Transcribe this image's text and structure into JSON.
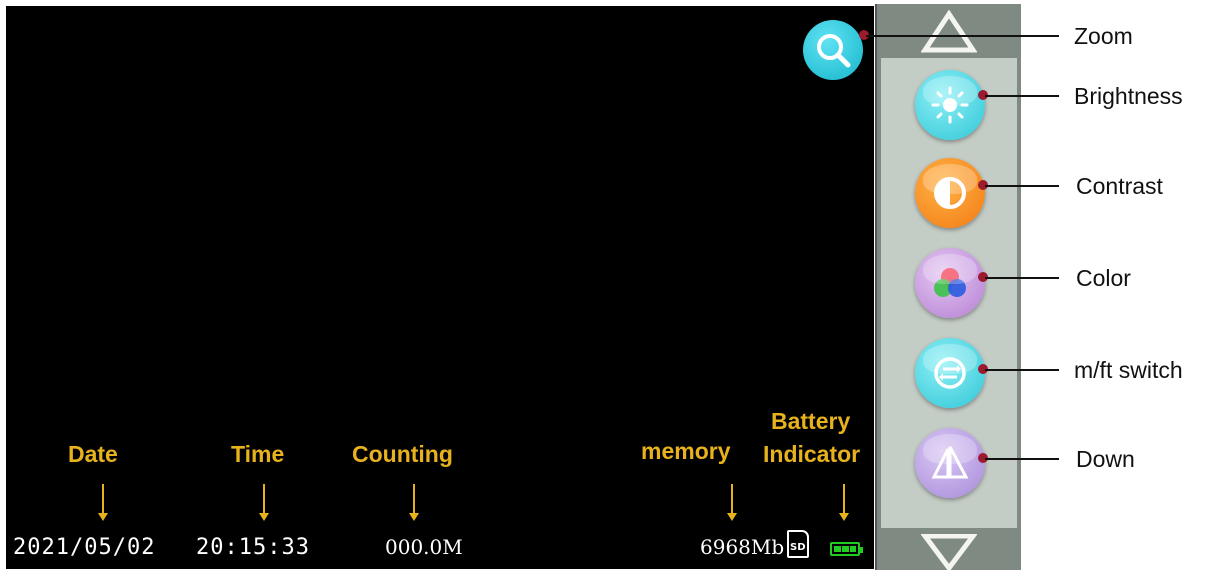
{
  "status_bar": {
    "date": "2021/05/02",
    "time": "20:15:33",
    "counting": "000.0M",
    "memory": "6968Mb",
    "sd_label": "SD"
  },
  "overlay_labels": {
    "date": "Date",
    "time": "Time",
    "counting": "Counting",
    "memory": "memory",
    "battery_line1": "Battery",
    "battery_line2": "Indicator"
  },
  "callouts": {
    "zoom": "Zoom",
    "brightness": "Brightness",
    "contrast": "Contrast",
    "color": "Color",
    "mft_switch": "m/ft switch",
    "down": "Down"
  },
  "icons": {
    "zoom": "magnifier-icon",
    "brightness": "sun-icon",
    "contrast": "half-circle-icon",
    "color": "color-circles-icon",
    "mft_switch": "swap-arrows-icon",
    "down": "triangle-ruler-icon",
    "up": "triangle-up-icon",
    "down_arrow": "triangle-down-icon"
  },
  "colors": {
    "label_yellow": "#e8b21c",
    "battery_green": "#22cc22",
    "zoom_cyan": "#15b5ca",
    "contrast_orange": "#f27a12",
    "color_purple": "#b57fd3",
    "down_purple": "#a789d9",
    "dot_red": "#9b1a2e"
  }
}
